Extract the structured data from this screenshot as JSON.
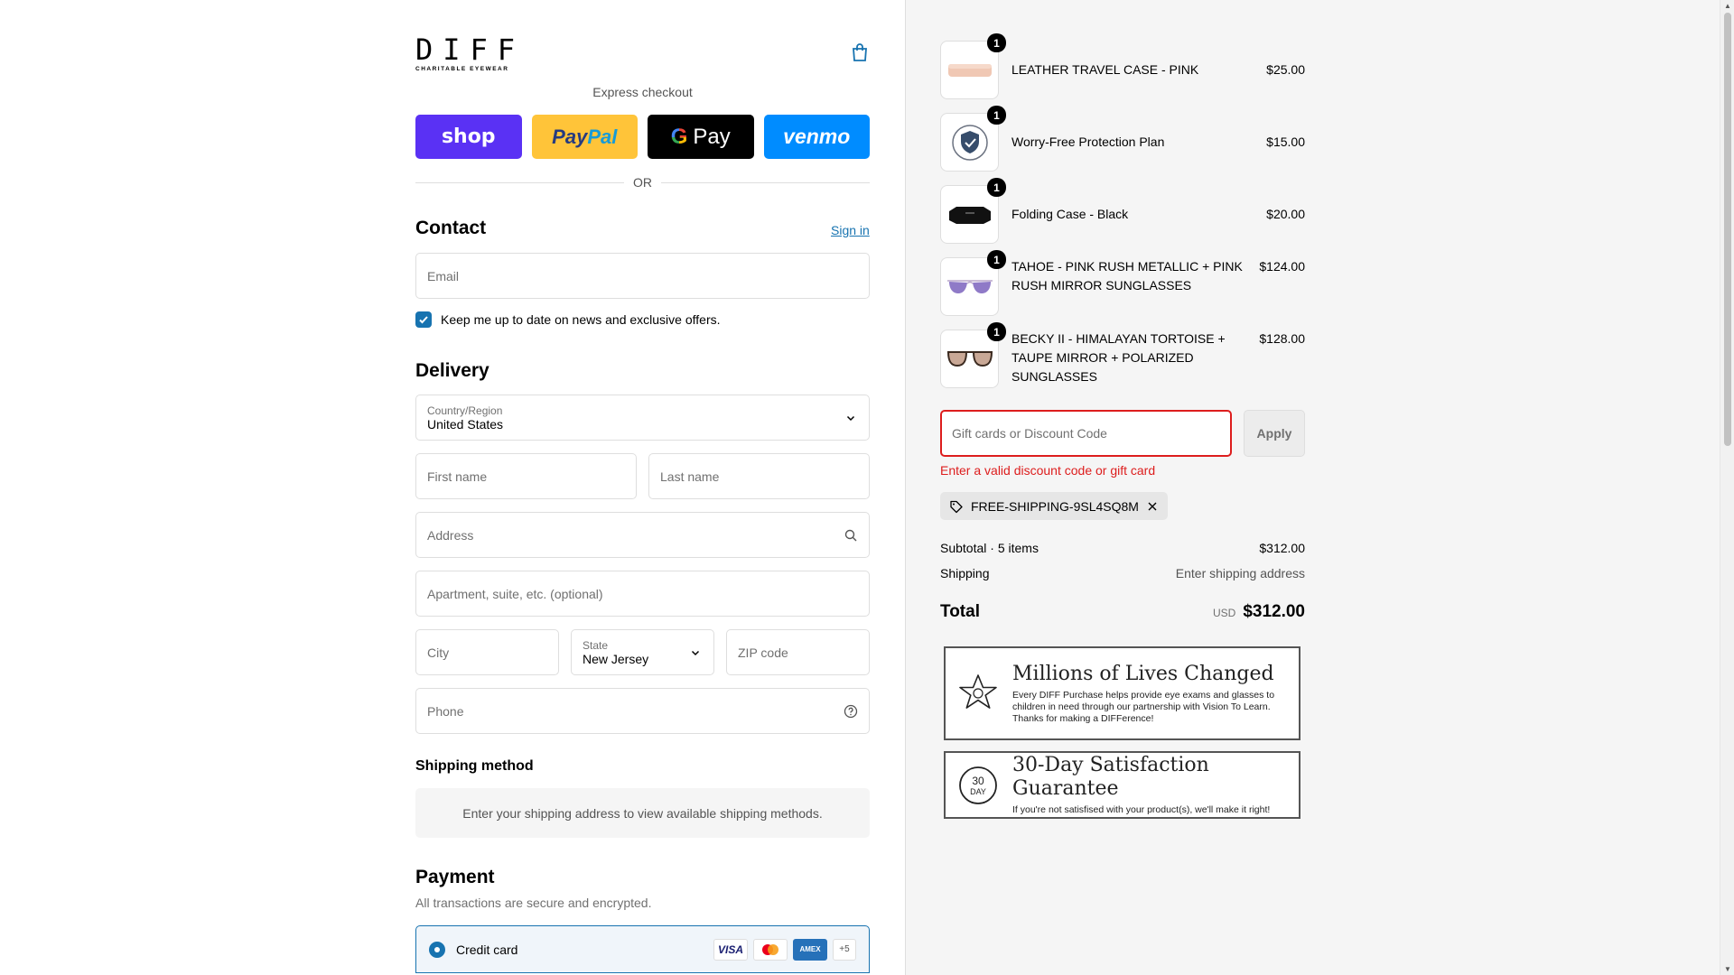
{
  "brand": {
    "name": "DIFF",
    "tagline": "CHARITABLE EYEWEAR"
  },
  "express": {
    "title": "Express checkout",
    "buttons": {
      "shop": "shop",
      "paypal_a": "Pay",
      "paypal_b": "Pal",
      "gpay_g": "G",
      "gpay": "Pay",
      "venmo": "venmo"
    },
    "or": "OR"
  },
  "contact": {
    "title": "Contact",
    "sign_in": "Sign in",
    "email_placeholder": "Email",
    "newsletter_label": "Keep me up to date on news and exclusive offers.",
    "newsletter_checked": true
  },
  "delivery": {
    "title": "Delivery",
    "country_label": "Country/Region",
    "country_value": "United States",
    "first_name": "First name",
    "last_name": "Last name",
    "address": "Address",
    "apartment": "Apartment, suite, etc. (optional)",
    "city": "City",
    "state_label": "State",
    "state_value": "New Jersey",
    "zip": "ZIP code",
    "phone": "Phone"
  },
  "shipping": {
    "title": "Shipping method",
    "message": "Enter your shipping address to view available shipping methods."
  },
  "payment": {
    "title": "Payment",
    "subtitle": "All transactions are secure and encrypted.",
    "method": "Credit card",
    "cards": [
      "VISA",
      "MC",
      "AMEX"
    ],
    "more_cards": "+5"
  },
  "cart": {
    "items": [
      {
        "name": "LEATHER TRAVEL CASE - PINK",
        "price": "$25.00",
        "qty": "1",
        "thumb": "pink-case"
      },
      {
        "name": "Worry-Free Protection Plan",
        "price": "$15.00",
        "qty": "1",
        "thumb": "shield"
      },
      {
        "name": "Folding Case - Black",
        "price": "$20.00",
        "qty": "1",
        "thumb": "black-case"
      },
      {
        "name": "TAHOE - PINK RUSH METALLIC + PINK RUSH MIRROR SUNGLASSES",
        "price": "$124.00",
        "qty": "1",
        "thumb": "aviator"
      },
      {
        "name": "BECKY II - HIMALAYAN TORTOISE + TAUPE MIRROR + POLARIZED SUNGLASSES",
        "price": "$128.00",
        "qty": "1",
        "thumb": "tortoise"
      }
    ],
    "discount_placeholder": "Gift cards or Discount Code",
    "apply": "Apply",
    "error": "Enter a valid discount code or gift card",
    "applied_code": "FREE-SHIPPING-9SL4SQ8M",
    "subtotal_label": "Subtotal · 5 items",
    "subtotal_value": "$312.00",
    "shipping_label": "Shipping",
    "shipping_value": "Enter shipping address",
    "total_label": "Total",
    "currency": "USD",
    "total_value": "$312.00"
  },
  "banners": [
    {
      "title": "Millions of Lives Changed",
      "text": "Every DIFF Purchase helps provide eye exams and glasses to children in need through our partnership with Vision To Learn. Thanks for making a DIFFerence!",
      "icon": "star-icon"
    },
    {
      "title": "30-Day Satisfaction Guarantee",
      "text": "If you're not satisfised with your product(s), we'll make it right!",
      "icon": "30-day-icon",
      "badge_top": "30",
      "badge_bottom": "DAY"
    }
  ],
  "colors": {
    "accent": "#1773b0",
    "error": "#dd1d1d",
    "shop": "#5a31f4",
    "paypal": "#ffc439",
    "venmo": "#008cff"
  }
}
